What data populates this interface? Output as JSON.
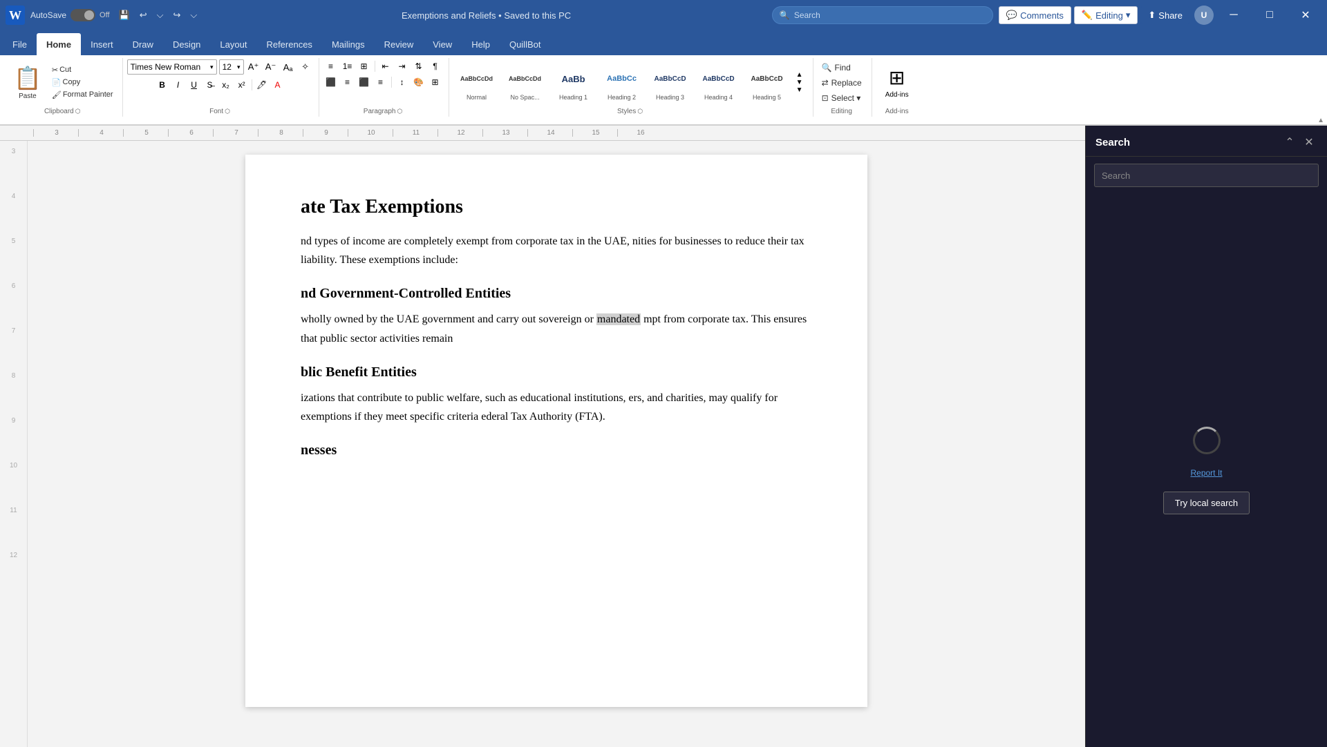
{
  "titlebar": {
    "word_icon": "W",
    "autosave_label": "AutoSave",
    "toggle_state": "Off",
    "doc_title": "Exemptions and Reliefs • Saved to this PC",
    "search_placeholder": "Search",
    "comments_label": "Comments",
    "editing_label": "Editing",
    "share_label": "Share"
  },
  "ribbon": {
    "tabs": [
      "File",
      "Home",
      "Insert",
      "Draw",
      "Design",
      "Layout",
      "References",
      "Mailings",
      "Review",
      "View",
      "Help",
      "QuillBot"
    ],
    "active_tab": "Home",
    "clipboard": {
      "label": "Clipboard",
      "paste_label": "Paste",
      "cut_label": "Cut",
      "copy_label": "Copy",
      "format_painter_label": "Format Painter"
    },
    "font": {
      "label": "Font",
      "font_name": "Times New Roman",
      "font_size": "12",
      "bold": "B",
      "italic": "I",
      "underline": "U",
      "strikethrough": "S",
      "subscript": "x₂",
      "superscript": "x²"
    },
    "paragraph": {
      "label": "Paragraph"
    },
    "styles": {
      "label": "Styles",
      "items": [
        {
          "preview": "AaBbCcDd",
          "name": "Normal",
          "color": "#333"
        },
        {
          "preview": "AaBbCcDd",
          "name": "No Spac...",
          "color": "#333"
        },
        {
          "preview": "AaBb",
          "name": "Heading 1",
          "color": "#1f3864",
          "size": "large"
        },
        {
          "preview": "AaBbCc",
          "name": "Heading 2",
          "color": "#2e74b5"
        },
        {
          "preview": "AaBbCcI",
          "name": "Heading 3",
          "color": "#1f3864"
        },
        {
          "preview": "AaBbCcI",
          "name": "Heading 4",
          "color": "#1f3864"
        },
        {
          "preview": "AaBbCcI",
          "name": "Heading 5",
          "color": "#333"
        }
      ]
    },
    "editing": {
      "label": "Editing",
      "find_label": "Find",
      "replace_label": "Replace",
      "select_label": "Select ▾"
    },
    "addins": {
      "label": "Add-ins",
      "icon": "⊞"
    }
  },
  "document": {
    "main_title": "ate Tax Exemptions",
    "paragraphs": [
      {
        "type": "body",
        "text": "nd types of income are completely exempt from corporate tax in the UAE, nities for businesses to reduce their tax liability. These exemptions include:"
      }
    ],
    "sections": [
      {
        "heading": "nd Government-Controlled Entities",
        "text": "wholly owned by the UAE government and carry out sovereign or mandated mpt from corporate tax. This ensures that public sector activities remain"
      },
      {
        "heading": "blic Benefit Entities",
        "text": "izations that contribute to public welfare, such as educational institutions, ers, and charities, may qualify for exemptions if they meet specific criteria ederal Tax Authority (FTA)."
      },
      {
        "heading": "nesses",
        "text": ""
      }
    ],
    "highlighted_word": "mandated"
  },
  "search_panel": {
    "title": "Search",
    "input_placeholder": "Search",
    "report_link_text": "Report It",
    "local_search_btn_text": "Try local search",
    "status": "loading"
  }
}
